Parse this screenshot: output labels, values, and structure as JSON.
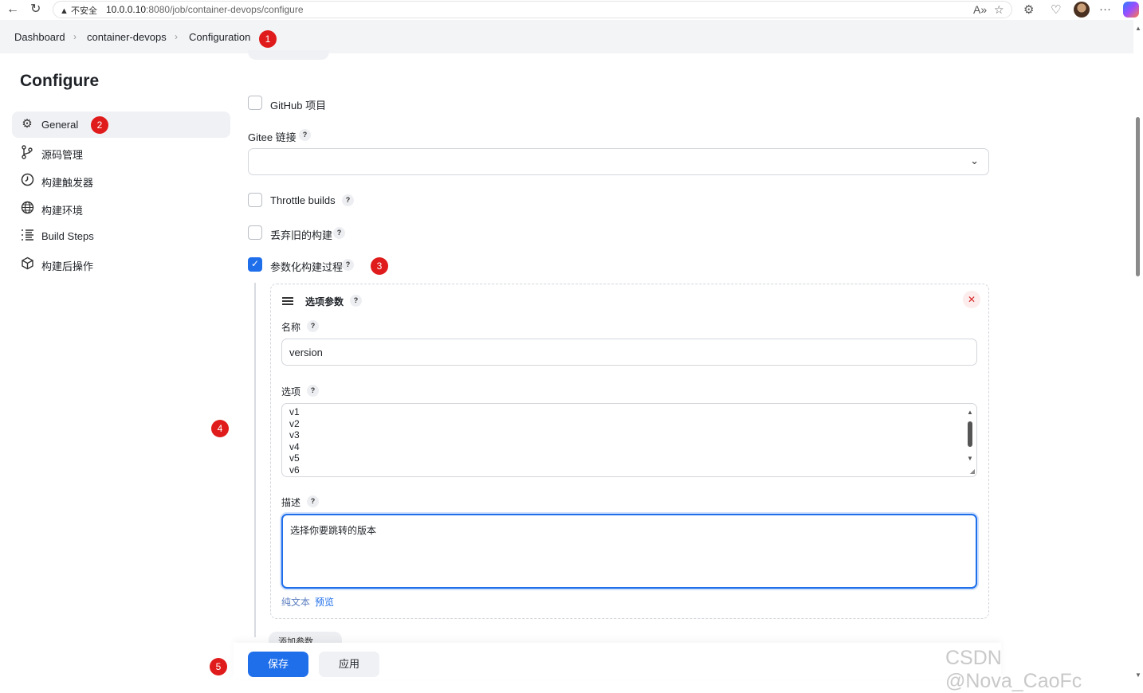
{
  "browser": {
    "security_label": "不安全",
    "url_host": "10.0.0.10",
    "url_path": ":8080/job/container-devops/configure"
  },
  "breadcrumb": {
    "items": [
      "Dashboard",
      "container-devops",
      "Configuration"
    ]
  },
  "sidebar": {
    "title": "Configure",
    "items": [
      {
        "label": "General",
        "icon": "gear-icon"
      },
      {
        "label": "源码管理",
        "icon": "branch-icon"
      },
      {
        "label": "构建触发器",
        "icon": "clock-icon"
      },
      {
        "label": "构建环境",
        "icon": "globe-icon"
      },
      {
        "label": "Build Steps",
        "icon": "list-icon"
      },
      {
        "label": "构建后操作",
        "icon": "box-icon"
      }
    ]
  },
  "form": {
    "github_project": {
      "label": "GitHub 项目",
      "checked": false
    },
    "gitee_link": {
      "label": "Gitee 链接",
      "value": ""
    },
    "throttle_builds": {
      "label": "Throttle builds",
      "checked": false
    },
    "discard_old": {
      "label": "丢弃旧的构建",
      "checked": false
    },
    "parameterized": {
      "label": "参数化构建过程",
      "checked": true
    },
    "choice_param": {
      "title": "选项参数",
      "name_label": "名称",
      "name_value": "version",
      "choices_label": "选项",
      "choices": [
        "v1",
        "v2",
        "v3",
        "v4",
        "v5",
        "v6"
      ],
      "description_label": "描述",
      "description_value": "选择你要跳转的版本",
      "plain_text_link": "纯文本",
      "preview_link": "预览"
    },
    "add_param_label": "添加参数"
  },
  "buttons": {
    "save": "保存",
    "apply": "应用"
  },
  "annotations": [
    "1",
    "2",
    "3",
    "4",
    "5"
  ],
  "watermark": "CSDN @Nova_CaoFc",
  "colors": {
    "accent": "#1f6feb",
    "badge": "#e01b1b"
  }
}
